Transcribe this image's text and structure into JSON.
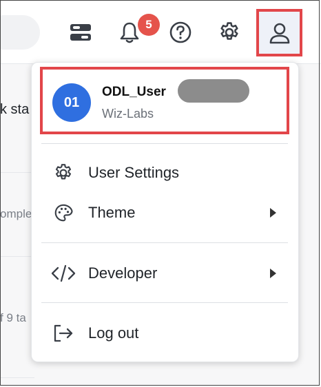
{
  "header": {
    "notifications_count": "5"
  },
  "background": {
    "snippet_1": "k sta",
    "snippet_2": "omple",
    "snippet_3": "f 9 ta"
  },
  "user_menu": {
    "profile": {
      "avatar_initials": "01",
      "username": "ODL_User",
      "organization": "Wiz-Labs"
    },
    "items": [
      {
        "label": "User Settings",
        "icon": "gear-icon",
        "has_submenu": false
      },
      {
        "label": "Theme",
        "icon": "palette-icon",
        "has_submenu": true
      },
      {
        "label": "Developer",
        "icon": "code-icon",
        "has_submenu": true
      },
      {
        "label": "Log out",
        "icon": "logout-icon",
        "has_submenu": false
      }
    ]
  },
  "colors": {
    "highlight": "#e2464a",
    "avatar": "#2f6fe0",
    "badge": "#e5534b"
  }
}
